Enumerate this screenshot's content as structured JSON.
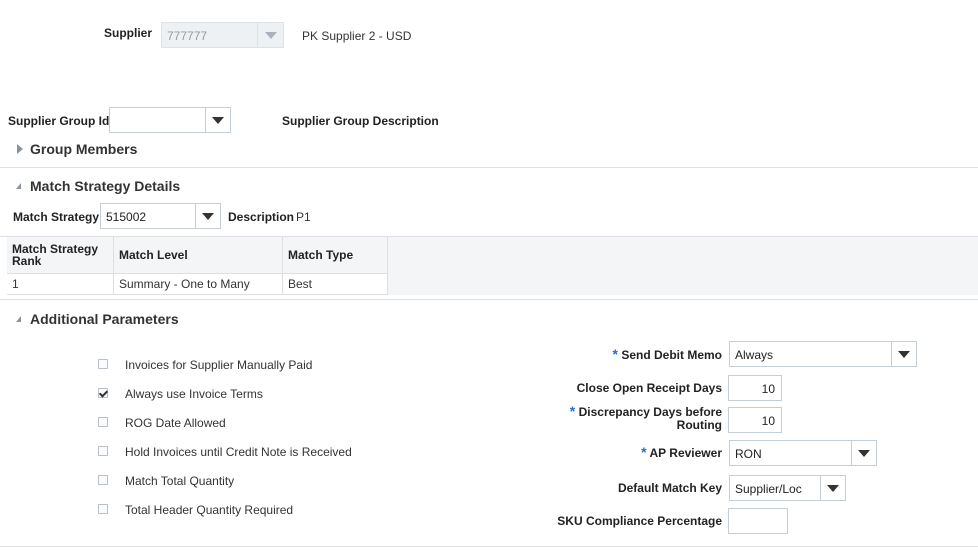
{
  "supplier": {
    "label": "Supplier",
    "id_value": "777777",
    "name": "PK Supplier 2 - USD"
  },
  "supplier_group": {
    "id_label": "Supplier Group Id",
    "id_value": "",
    "description_label": "Supplier Group Description"
  },
  "sections": {
    "group_members": "Group Members",
    "match_strategy_details": "Match Strategy Details",
    "additional_parameters": "Additional Parameters"
  },
  "match_strategy": {
    "label": "Match Strategy",
    "value": "515002",
    "description_label": "Description",
    "description_value": "P1",
    "table": {
      "headers": [
        "Match Strategy Rank",
        "Match Level",
        "Match Type"
      ],
      "rows": [
        [
          "1",
          "Summary - One to Many",
          "Best"
        ]
      ]
    }
  },
  "checkboxes": [
    {
      "label": "Invoices for Supplier Manually Paid",
      "checked": false
    },
    {
      "label": "Always use Invoice Terms",
      "checked": true
    },
    {
      "label": "ROG Date Allowed",
      "checked": false
    },
    {
      "label": "Hold Invoices until Credit Note is Received",
      "checked": false
    },
    {
      "label": "Match Total Quantity",
      "checked": false
    },
    {
      "label": "Total Header Quantity Required",
      "checked": false
    }
  ],
  "params": {
    "send_debit_memo": {
      "label": "Send Debit Memo",
      "required": "*",
      "value": "Always"
    },
    "close_open_receipt_days": {
      "label": "Close Open Receipt Days",
      "value": "10"
    },
    "discrepancy_days": {
      "label_line1": "Discrepancy Days before",
      "label_line2": "Routing",
      "required": "*",
      "value": "10"
    },
    "ap_reviewer": {
      "label": "AP Reviewer",
      "required": "*",
      "value": "RON"
    },
    "default_match_key": {
      "label": "Default Match Key",
      "value": "Supplier/Loc"
    },
    "sku_compliance": {
      "label": "SKU Compliance Percentage",
      "value": ""
    }
  }
}
